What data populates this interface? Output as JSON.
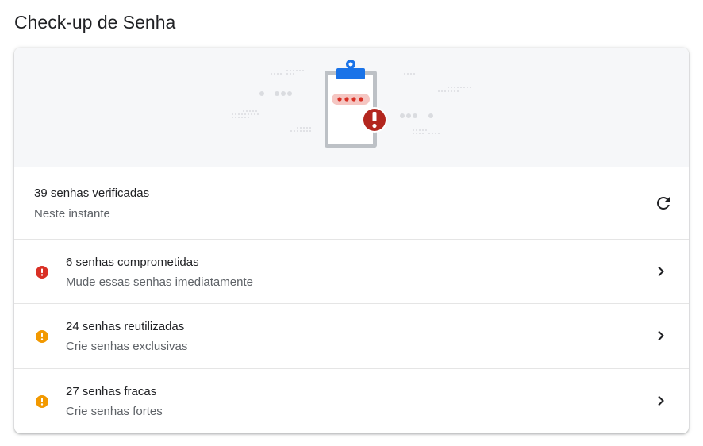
{
  "page": {
    "title": "Check-up de Senha"
  },
  "status": {
    "title": "39 senhas verificadas",
    "subtitle": "Neste instante",
    "action_icon": "refresh-icon"
  },
  "items": [
    {
      "title": "6 senhas comprometidas",
      "subtitle": "Mude essas senhas imediatamente",
      "icon": "error-icon",
      "color": "#d93025"
    },
    {
      "title": "24 senhas reutilizadas",
      "subtitle": "Crie senhas exclusivas",
      "icon": "warning-icon",
      "color": "#f29900"
    },
    {
      "title": "27 senhas fracas",
      "subtitle": "Crie senhas fortes",
      "icon": "warning-icon",
      "color": "#f29900"
    }
  ],
  "colors": {
    "banner_bg": "#f6f7f9",
    "clip_blue": "#1a73e8",
    "error_red": "#b3261e",
    "dot_gray": "#dadce0"
  }
}
